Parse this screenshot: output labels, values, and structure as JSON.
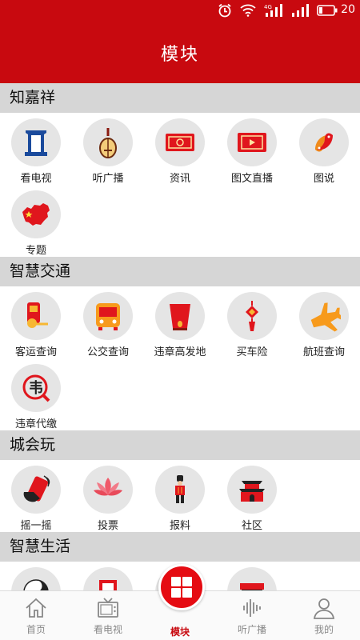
{
  "status_bar": {
    "battery_text": "20",
    "network_label": "4G"
  },
  "header": {
    "title": "模块"
  },
  "sections": [
    {
      "title": "知嘉祥",
      "items": [
        {
          "label": "看电视",
          "icon": "tv-tower-icon"
        },
        {
          "label": "听广播",
          "icon": "pipa-lute-icon"
        },
        {
          "label": "资讯",
          "icon": "news-ticket-icon"
        },
        {
          "label": "图文直播",
          "icon": "live-video-icon"
        },
        {
          "label": "图说",
          "icon": "koi-fish-icon"
        },
        {
          "label": "专题",
          "icon": "china-map-icon"
        }
      ]
    },
    {
      "title": "智慧交通",
      "items": [
        {
          "label": "客运查询",
          "icon": "ticket-machine-icon"
        },
        {
          "label": "公交查询",
          "icon": "bus-icon"
        },
        {
          "label": "违章高发地",
          "icon": "lantern-icon"
        },
        {
          "label": "买车险",
          "icon": "chinese-knot-icon"
        },
        {
          "label": "航班查询",
          "icon": "airplane-icon"
        },
        {
          "label": "违章代缴",
          "icon": "violation-stamp-icon"
        }
      ]
    },
    {
      "title": "城会玩",
      "items": [
        {
          "label": "摇一摇",
          "icon": "shake-phone-icon"
        },
        {
          "label": "投票",
          "icon": "lotus-icon"
        },
        {
          "label": "报料",
          "icon": "guard-figure-icon"
        },
        {
          "label": "社区",
          "icon": "gate-tower-icon"
        }
      ]
    },
    {
      "title": "智慧生活",
      "items": [
        {
          "label": "",
          "icon": "yin-yang-icon"
        },
        {
          "label": "",
          "icon": "tv-frame-icon"
        },
        {
          "label": "",
          "icon": "hidden-icon"
        },
        {
          "label": "",
          "icon": "roof-icon"
        }
      ]
    }
  ],
  "tabbar": {
    "tabs": [
      {
        "label": "首页",
        "icon": "home-icon"
      },
      {
        "label": "看电视",
        "icon": "tv-icon"
      },
      {
        "label": "模块",
        "icon": "grid-icon"
      },
      {
        "label": "听广播",
        "icon": "sound-wave-icon"
      },
      {
        "label": "我的",
        "icon": "user-icon"
      }
    ],
    "active_index": 2
  },
  "colors": {
    "brand_red": "#c8090f",
    "accent_red": "#e50b12",
    "section_bg": "#d6d6d6",
    "circle_bg": "#e5e5e5"
  }
}
